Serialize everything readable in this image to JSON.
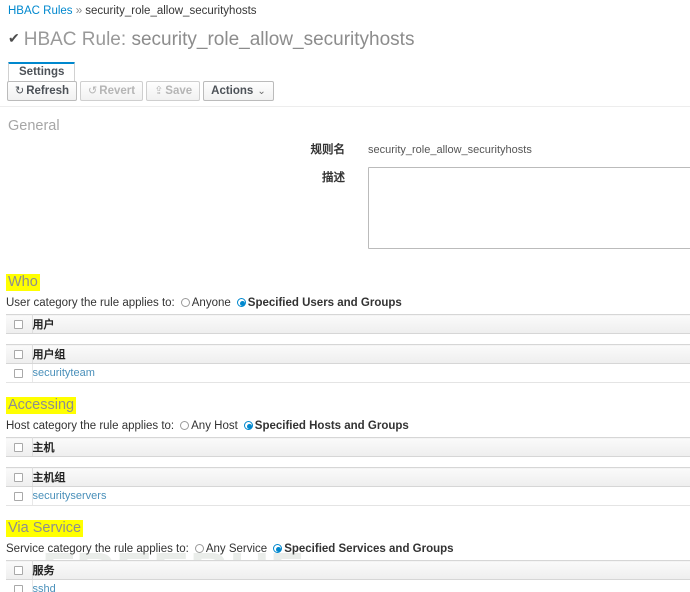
{
  "breadcrumb": {
    "root_label": "HBAC Rules",
    "separator": "»",
    "current_label": "security_role_allow_securityhosts"
  },
  "page": {
    "check_icon": "check-icon",
    "title_prefix": "HBAC Rule:",
    "title_name": "security_role_allow_securityhosts"
  },
  "tabs": [
    {
      "label": "Settings",
      "active": true
    }
  ],
  "toolbar": {
    "refresh_label": "Refresh",
    "refresh_icon": "refresh-icon",
    "revert_label": "Revert",
    "revert_icon": "undo-icon",
    "save_label": "Save",
    "save_icon": "save-icon",
    "actions_label": "Actions",
    "actions_caret": "⌄"
  },
  "general": {
    "heading": "General",
    "rule_name_label": "规则名",
    "rule_name_value": "security_role_allow_securityhosts",
    "description_label": "描述",
    "description_value": ""
  },
  "who": {
    "heading": "Who",
    "category_label": "User category the rule applies to:",
    "option_any": "Anyone",
    "option_specified": "Specified Users and Groups",
    "selected": "Specified Users and Groups",
    "users_table": {
      "column_header": "用户",
      "rows": []
    },
    "groups_table": {
      "column_header": "用户组",
      "rows": [
        {
          "name": "securityteam"
        }
      ]
    }
  },
  "accessing": {
    "heading": "Accessing",
    "category_label": "Host category the rule applies to:",
    "option_any": "Any Host",
    "option_specified": "Specified Hosts and Groups",
    "selected": "Specified Hosts and Groups",
    "hosts_table": {
      "column_header": "主机",
      "rows": []
    },
    "hostgroups_table": {
      "column_header": "主机组",
      "rows": [
        {
          "name": "securityservers"
        }
      ]
    }
  },
  "via_service": {
    "heading": "Via Service",
    "category_label": "Service category the rule applies to:",
    "option_any": "Any Service",
    "option_specified": "Specified Services and Groups",
    "selected": "Specified Services and Groups",
    "services_table": {
      "column_header": "服务",
      "rows": [
        {
          "name": "sshd"
        }
      ]
    }
  },
  "watermark": {
    "text": "FREEBUF"
  },
  "colors": {
    "link": "#0088ce",
    "table_link": "#4a90ba",
    "tab_accent": "#0088ce",
    "highlight": "#ffff00",
    "heading_gray": "#999999"
  }
}
